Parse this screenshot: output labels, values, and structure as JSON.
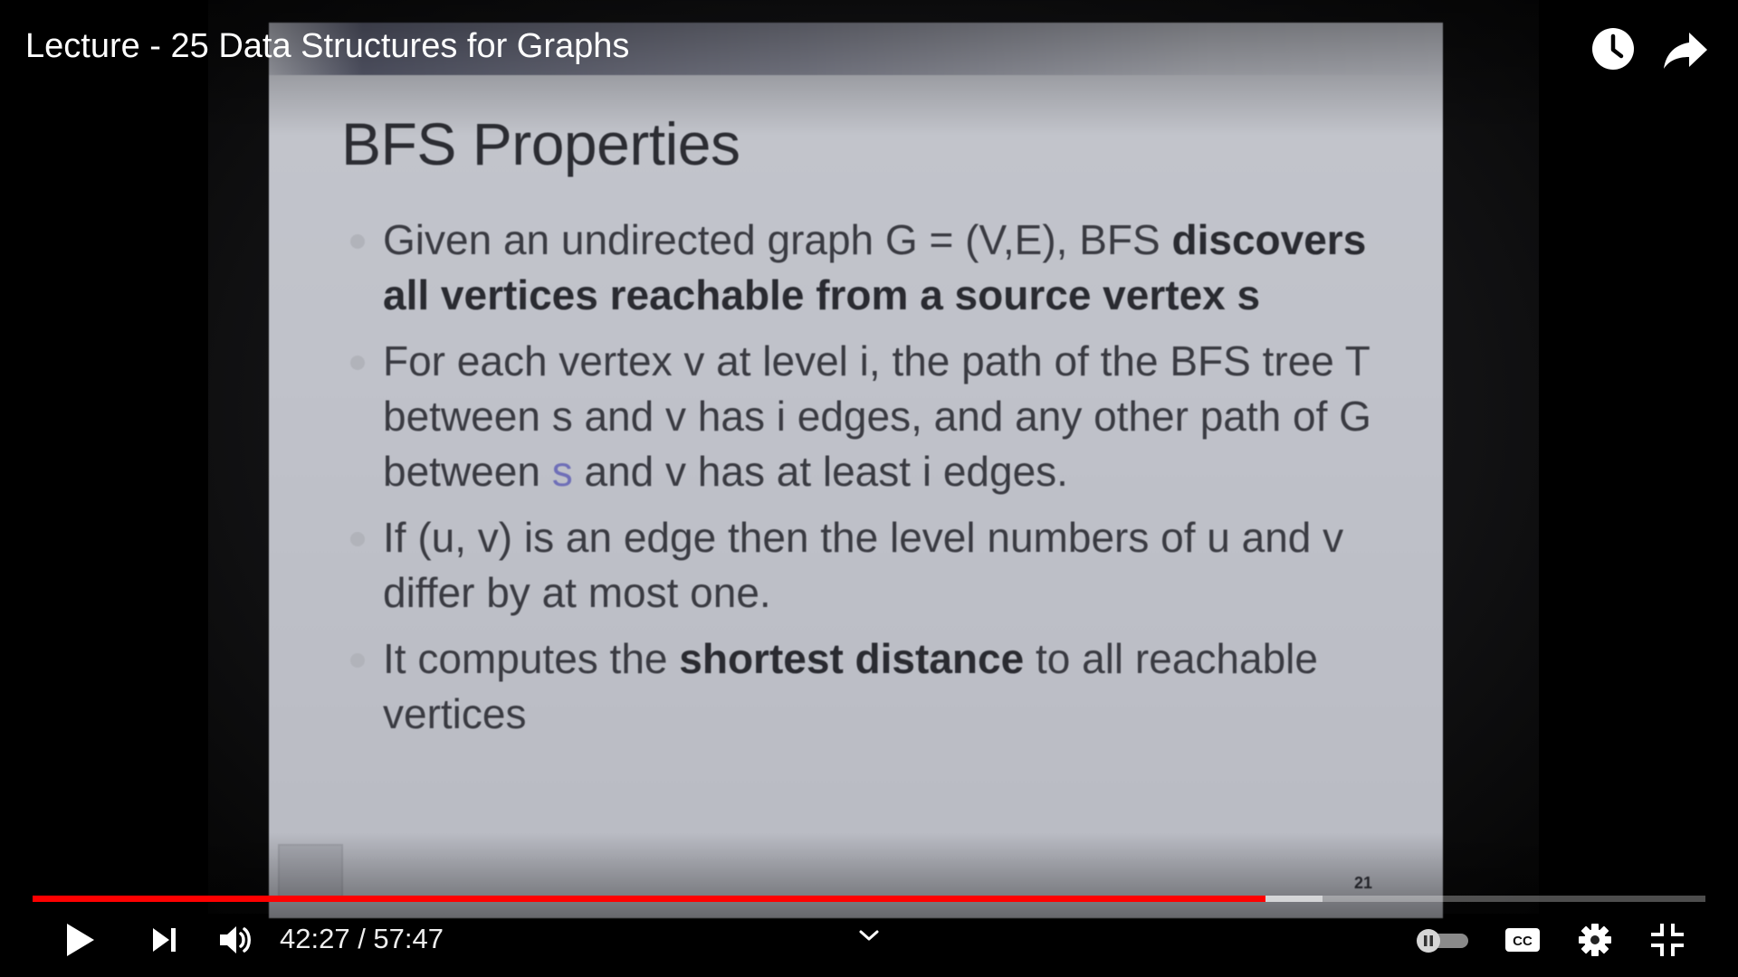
{
  "video": {
    "title": "Lecture - 25 Data Structures for Graphs"
  },
  "slide": {
    "title": "BFS Properties",
    "page_number": "21",
    "bullets": [
      {
        "parts": [
          {
            "text": "Given an undirected  graph G = (V,E), BFS ",
            "bold": false
          },
          {
            "text": "discovers all vertices reachable from a source vertex s",
            "bold": true
          }
        ]
      },
      {
        "parts": [
          {
            "text": "For each vertex v at level i, the path of the BFS tree T between s and v has i edges, and any other path of G between ",
            "bold": false
          },
          {
            "text": "s",
            "bold": false,
            "highlight": true
          },
          {
            "text": " and v has at least i edges.",
            "bold": false
          }
        ]
      },
      {
        "parts": [
          {
            "text": "If (u, v) is an edge then the level numbers of u and v differ by at most one.",
            "bold": false
          }
        ]
      },
      {
        "parts": [
          {
            "text": "It computes the ",
            "bold": false
          },
          {
            "text": "shortest distance",
            "bold": true
          },
          {
            "text": " to all reachable vertices",
            "bold": false
          }
        ]
      }
    ]
  },
  "player": {
    "current_time": "42:27",
    "separator": " / ",
    "duration": "57:47",
    "progress_played_fraction": 0.737,
    "progress_buffered_fraction": 0.771,
    "colors": {
      "progress": "#ff0000",
      "accent": "#ffffff"
    },
    "controls": {
      "play": "play-icon",
      "next": "next-icon",
      "volume": "volume-icon",
      "chapters": "chevron-down-icon",
      "autoplay": "autoplay-toggle-icon",
      "captions": "cc-icon",
      "settings": "gear-icon",
      "fullscreen_exit": "exit-fullscreen-icon",
      "watch_later": "clock-icon",
      "share": "share-icon"
    }
  }
}
